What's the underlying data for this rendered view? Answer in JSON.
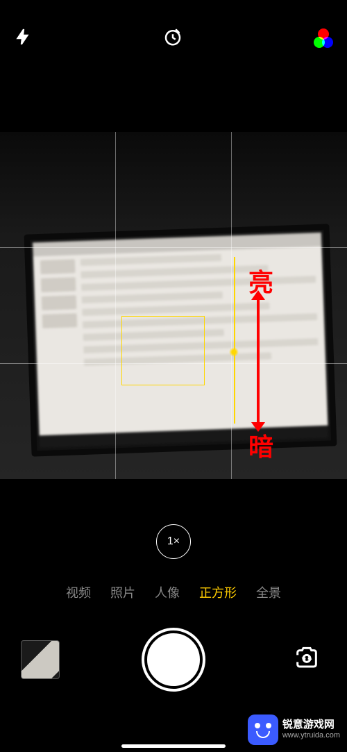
{
  "topBar": {
    "flash": "flash-off",
    "timer": "timer",
    "filter": "filters"
  },
  "annotations": {
    "bright": "亮",
    "dark": "暗"
  },
  "zoom": {
    "level": "1×"
  },
  "modes": {
    "items": [
      {
        "label": "视频",
        "active": false
      },
      {
        "label": "照片",
        "active": false
      },
      {
        "label": "人像",
        "active": false
      },
      {
        "label": "正方形",
        "active": true
      },
      {
        "label": "全景",
        "active": false
      }
    ]
  },
  "controls": {
    "thumbnail": "last-photo",
    "shutter": "shutter",
    "switch": "switch-camera"
  },
  "watermark": {
    "title": "锐意游戏网",
    "url": "www.ytruida.com"
  }
}
